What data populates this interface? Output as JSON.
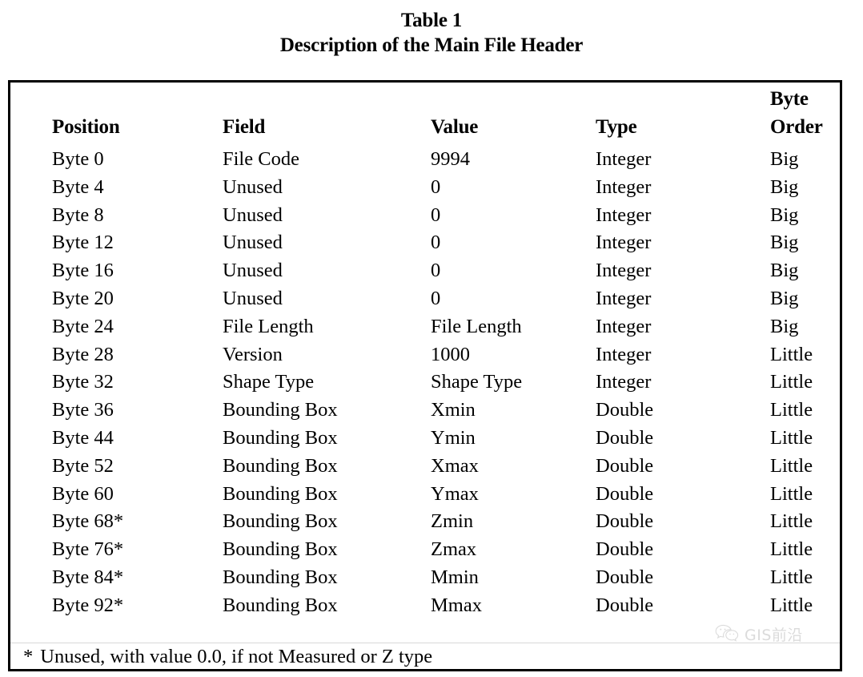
{
  "title": {
    "line1": "Table 1",
    "line2": "Description of the Main File Header"
  },
  "table": {
    "columns": {
      "position": "Position",
      "field": "Field",
      "value": "Value",
      "type": "Type",
      "byte_order_line1": "Byte",
      "byte_order_line2": "Order"
    },
    "rows": [
      {
        "position": "Byte 0",
        "field": "File Code",
        "value": "9994",
        "type": "Integer",
        "byte_order": "Big"
      },
      {
        "position": "Byte 4",
        "field": "Unused",
        "value": "0",
        "type": "Integer",
        "byte_order": "Big"
      },
      {
        "position": "Byte 8",
        "field": "Unused",
        "value": "0",
        "type": "Integer",
        "byte_order": "Big"
      },
      {
        "position": "Byte 12",
        "field": "Unused",
        "value": "0",
        "type": "Integer",
        "byte_order": "Big"
      },
      {
        "position": "Byte 16",
        "field": "Unused",
        "value": "0",
        "type": "Integer",
        "byte_order": "Big"
      },
      {
        "position": "Byte 20",
        "field": "Unused",
        "value": "0",
        "type": "Integer",
        "byte_order": "Big"
      },
      {
        "position": "Byte 24",
        "field": "File Length",
        "value": "File Length",
        "type": "Integer",
        "byte_order": "Big"
      },
      {
        "position": "Byte 28",
        "field": "Version",
        "value": "1000",
        "type": "Integer",
        "byte_order": "Little"
      },
      {
        "position": "Byte 32",
        "field": "Shape Type",
        "value": "Shape Type",
        "type": "Integer",
        "byte_order": "Little"
      },
      {
        "position": "Byte 36",
        "field": "Bounding Box",
        "value": "Xmin",
        "type": "Double",
        "byte_order": "Little"
      },
      {
        "position": "Byte 44",
        "field": "Bounding Box",
        "value": "Ymin",
        "type": "Double",
        "byte_order": "Little"
      },
      {
        "position": "Byte 52",
        "field": "Bounding Box",
        "value": "Xmax",
        "type": "Double",
        "byte_order": "Little"
      },
      {
        "position": "Byte 60",
        "field": "Bounding Box",
        "value": "Ymax",
        "type": "Double",
        "byte_order": "Little"
      },
      {
        "position": "Byte 68*",
        "field": "Bounding Box",
        "value": "Zmin",
        "type": "Double",
        "byte_order": "Little"
      },
      {
        "position": "Byte 76*",
        "field": "Bounding Box",
        "value": "Zmax",
        "type": "Double",
        "byte_order": "Little"
      },
      {
        "position": "Byte 84*",
        "field": "Bounding Box",
        "value": "Mmin",
        "type": "Double",
        "byte_order": "Little"
      },
      {
        "position": "Byte 92*",
        "field": "Bounding Box",
        "value": "Mmax",
        "type": "Double",
        "byte_order": "Little"
      }
    ],
    "footnote": {
      "marker": "*",
      "text": "Unused, with value 0.0, if not Measured or Z type"
    }
  },
  "watermark": {
    "icon": "wechat-icon",
    "text": "GIS前沿",
    "color": "#8a8a8a"
  }
}
